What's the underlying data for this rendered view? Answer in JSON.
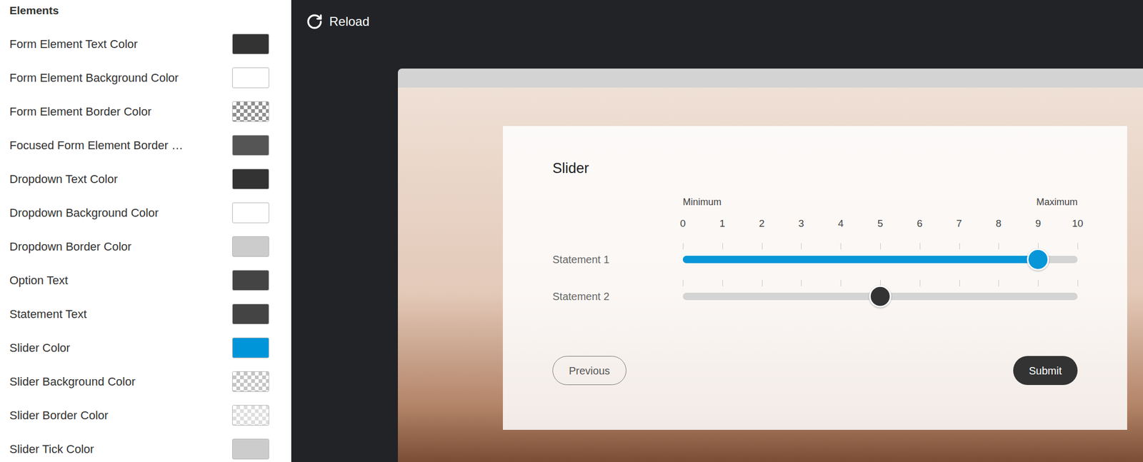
{
  "sidebar": {
    "title": "Elements",
    "items": [
      {
        "label": "Form Element Text Color",
        "color": "#333333",
        "kind": "solid"
      },
      {
        "label": "Form Element Background Color",
        "color": "#ffffff",
        "kind": "solid"
      },
      {
        "label": "Form Element Border Color",
        "color": "#8f8f8f",
        "kind": "checker"
      },
      {
        "label": "Focused Form Element Border …",
        "color": "#555555",
        "kind": "solid"
      },
      {
        "label": "Dropdown Text Color",
        "color": "#333333",
        "kind": "solid"
      },
      {
        "label": "Dropdown Background Color",
        "color": "#ffffff",
        "kind": "solid"
      },
      {
        "label": "Dropdown Border Color",
        "color": "#cccccc",
        "kind": "solid"
      },
      {
        "label": "Option Text",
        "color": "#444444",
        "kind": "solid"
      },
      {
        "label": "Statement Text",
        "color": "#444444",
        "kind": "solid"
      },
      {
        "label": "Slider Color",
        "color": "#0095d9",
        "kind": "solid"
      },
      {
        "label": "Slider Background Color",
        "color": "#c4c4c4",
        "kind": "checker"
      },
      {
        "label": "Slider Border Color",
        "color": "#dddddd",
        "kind": "checker"
      },
      {
        "label": "Slider Tick Color",
        "color": "#cccccc",
        "kind": "solid"
      }
    ]
  },
  "toolbar": {
    "reload": "Reload"
  },
  "survey": {
    "title": "Slider",
    "scale": {
      "min_label": "Minimum",
      "max_label": "Maximum",
      "ticks": [
        "0",
        "1",
        "2",
        "3",
        "4",
        "5",
        "6",
        "7",
        "8",
        "9",
        "10"
      ]
    },
    "statements": [
      {
        "label": "Statement 1",
        "level": 0.9,
        "answered": true
      },
      {
        "label": "Statement 2",
        "level": 0.5,
        "answered": false
      }
    ],
    "buttons": {
      "previous": "Previous",
      "submit": "Submit"
    }
  }
}
